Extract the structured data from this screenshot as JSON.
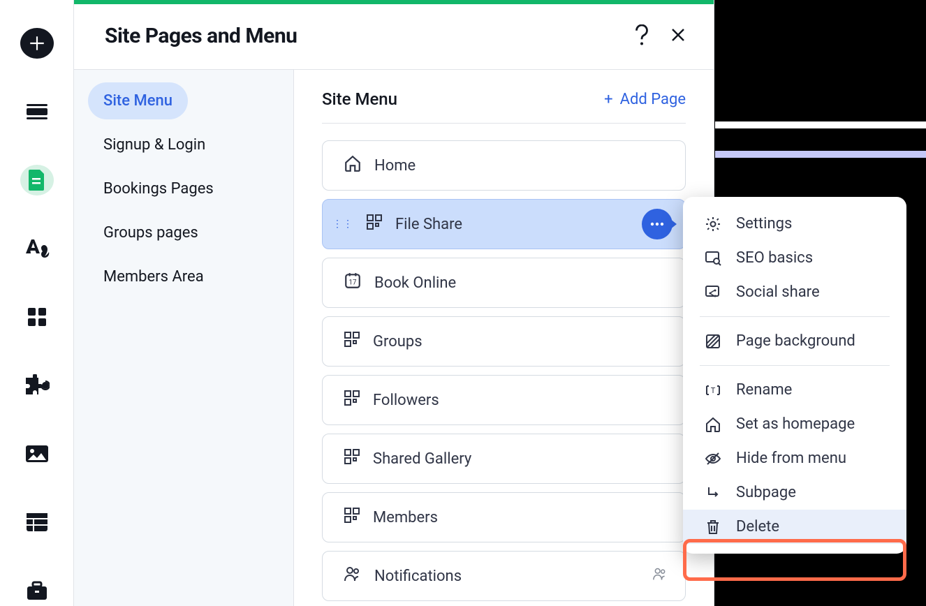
{
  "panel": {
    "title": "Site Pages and Menu",
    "add_page_label": "Add Page"
  },
  "sidebar": {
    "items": [
      {
        "label": "Site Menu",
        "active": true
      },
      {
        "label": "Signup & Login",
        "active": false
      },
      {
        "label": "Bookings Pages",
        "active": false
      },
      {
        "label": "Groups pages",
        "active": false
      },
      {
        "label": "Members Area",
        "active": false
      }
    ]
  },
  "main": {
    "title": "Site Menu"
  },
  "pages": [
    {
      "label": "Home",
      "icon": "home",
      "selected": false
    },
    {
      "label": "File Share",
      "icon": "grid",
      "selected": true
    },
    {
      "label": "Book Online",
      "icon": "calendar",
      "selected": false
    },
    {
      "label": "Groups",
      "icon": "grid",
      "selected": false
    },
    {
      "label": "Followers",
      "icon": "grid",
      "selected": false
    },
    {
      "label": "Shared Gallery",
      "icon": "grid",
      "selected": false
    },
    {
      "label": "Members",
      "icon": "grid",
      "selected": false
    },
    {
      "label": "Notifications",
      "icon": "people",
      "selected": false,
      "members_badge": true
    }
  ],
  "context_menu": {
    "items": [
      {
        "label": "Settings",
        "icon": "gear"
      },
      {
        "label": "SEO basics",
        "icon": "seo"
      },
      {
        "label": "Social share",
        "icon": "share"
      },
      {
        "divider": true
      },
      {
        "label": "Page background",
        "icon": "pattern"
      },
      {
        "divider": true
      },
      {
        "label": "Rename",
        "icon": "rename"
      },
      {
        "label": "Set as homepage",
        "icon": "home"
      },
      {
        "label": "Hide from menu",
        "icon": "hide"
      },
      {
        "label": "Subpage",
        "icon": "subpage"
      },
      {
        "label": "Delete",
        "icon": "trash",
        "highlighted": true
      }
    ]
  }
}
